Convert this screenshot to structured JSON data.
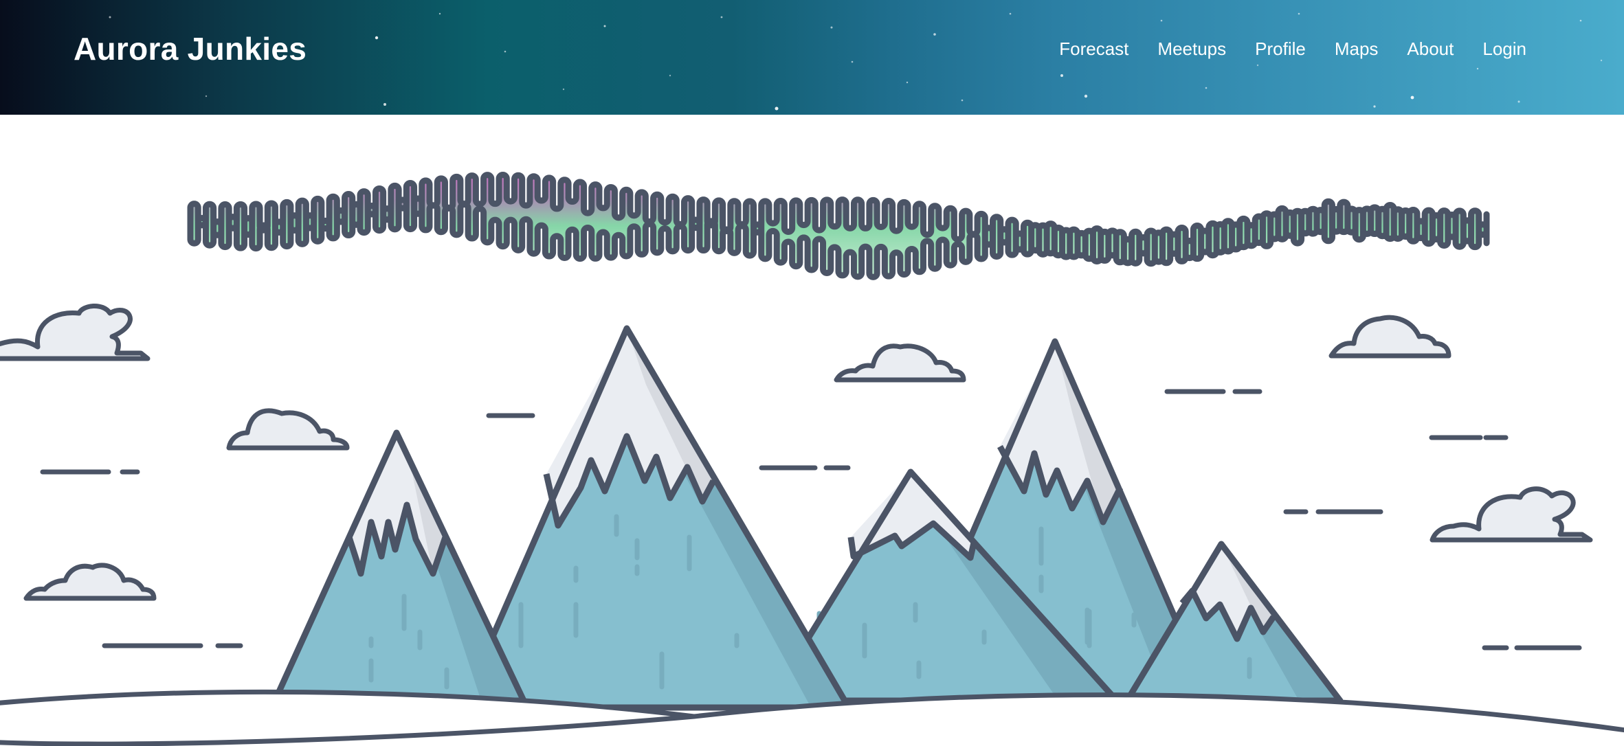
{
  "header": {
    "brand": "Aurora Junkies",
    "nav": [
      {
        "label": "Forecast"
      },
      {
        "label": "Meetups"
      },
      {
        "label": "Profile"
      },
      {
        "label": "Maps"
      },
      {
        "label": "About"
      },
      {
        "label": "Login"
      }
    ]
  },
  "hero": {
    "icons": [
      "aurora-icon",
      "mountain-icon",
      "cloud-icon",
      "wind-line-icon",
      "snow-hill-icon"
    ]
  },
  "colors": {
    "outline": "#4b5466",
    "mountain": "#86bfcf",
    "mountain_shadow": "#78adbe",
    "snow": "#eaedf2",
    "snow_shadow": "#d7dae0",
    "aurora_pink": "#c673c0",
    "aurora_green": "#86d6a8",
    "aurora_light": "#c3ecd2"
  }
}
